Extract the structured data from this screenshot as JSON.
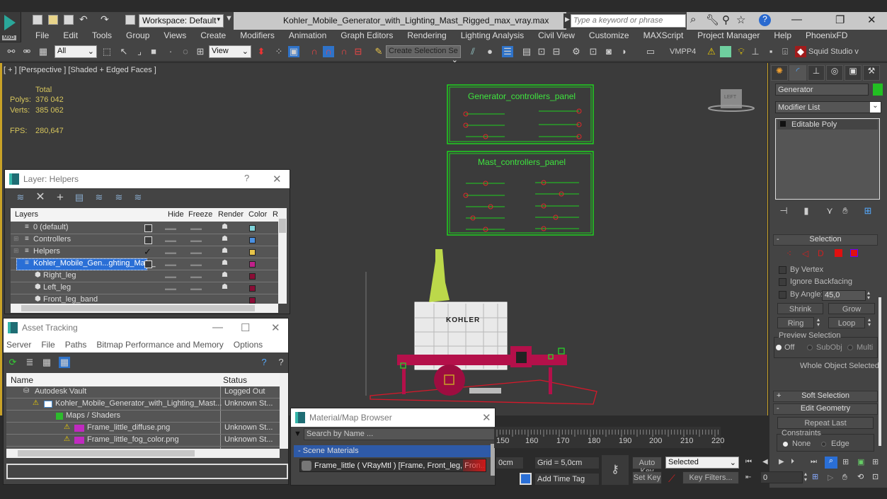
{
  "app": {
    "logo_label": "MXD",
    "workspace": "Workspace: Default",
    "title": "Kohler_Mobile_Generator_with_Lighting_Mast_Rigged_max_vray.max",
    "search_placeholder": "Type a keyword or phrase"
  },
  "menu": [
    "File",
    "Edit",
    "Tools",
    "Group",
    "Views",
    "Create",
    "Modifiers",
    "Animation",
    "Graph Editors",
    "Rendering",
    "Lighting Analysis",
    "Civil View",
    "Customize",
    "MAXScript",
    "Project Manager",
    "Help",
    "PhoenixFD"
  ],
  "toolbar": {
    "filter": "All",
    "ref_coord": "View",
    "named_selection": "Create Selection Se",
    "vmpp": "VMPP4",
    "squid": "Squid Studio v"
  },
  "viewport": {
    "label": "[ + ] [Perspective ] [Shaded + Edged Faces ]",
    "stats": {
      "total_label": "Total",
      "polys_label": "Polys:",
      "polys": "376 042",
      "verts_label": "Verts:",
      "verts": "385 062",
      "fps_label": "FPS:",
      "fps": "280,647"
    },
    "panels": [
      "Generator_controllers_panel",
      "Mast_controllers_panel"
    ],
    "brand_text": "KOHLER",
    "viewcube_label": "LEFT"
  },
  "layer_dialog": {
    "title": "Layer: Helpers",
    "columns": [
      "Layers",
      "",
      "Hide",
      "Freeze",
      "Render",
      "Color",
      "Ra"
    ],
    "rows": [
      {
        "name": "0 (default)",
        "active": false,
        "color": "#7fd3d9",
        "level": 0,
        "expand": false
      },
      {
        "name": "Controllers",
        "active": false,
        "color": "#4a90e2",
        "level": 0,
        "expand": true
      },
      {
        "name": "Helpers",
        "active": true,
        "color": "#e8c44a",
        "level": 0,
        "expand": true
      },
      {
        "name": "Kohler_Mobile_Gen...ghting_Mast_",
        "active": false,
        "color": "#c0208a",
        "level": 0,
        "expand": true,
        "selected": true
      },
      {
        "name": "Right_leg",
        "color": "#8a0d36",
        "level": 1
      },
      {
        "name": "Left_leg",
        "color": "#8a0d36",
        "level": 1
      },
      {
        "name": "Front_leg_band",
        "color": "#8a0d36",
        "level": 1
      }
    ]
  },
  "asset_dialog": {
    "title": "Asset Tracking",
    "menu": [
      "Server",
      "File",
      "Paths",
      "Bitmap Performance and Memory",
      "Options"
    ],
    "columns": [
      "Name",
      "Status"
    ],
    "rows": [
      {
        "name": "Autodesk Vault",
        "status": "Logged Out",
        "indent": 1
      },
      {
        "name": "Kohler_Mobile_Generator_with_Lighting_Mast...",
        "status": "Unknown St...",
        "indent": 2,
        "warn": true
      },
      {
        "name": "Maps / Shaders",
        "status": "",
        "indent": 3
      },
      {
        "name": "Frame_little_diffuse.png",
        "status": "Unknown St...",
        "indent": 4,
        "warn": true,
        "png": true
      },
      {
        "name": "Frame_little_fog_color.png",
        "status": "Unknown St...",
        "indent": 4,
        "warn": true,
        "png": true
      }
    ]
  },
  "material_browser": {
    "title": "Material/Map Browser",
    "search_placeholder": "Search by Name ...",
    "group": "- Scene Materials",
    "item": "Frame_little  ( VRayMtl )  [Frame, Front_leg, Fron..."
  },
  "command_panel": {
    "object_name": "Generator",
    "object_color": "#22c022",
    "modifier_list": "Modifier List",
    "stack": [
      "Editable Poly"
    ],
    "selection": {
      "title": "Selection",
      "by_vertex": "By Vertex",
      "ignore_backfacing": "Ignore Backfacing",
      "by_angle": "By Angle:",
      "angle_value": "45,0",
      "shrink": "Shrink",
      "grow": "Grow",
      "ring": "Ring",
      "loop": "Loop",
      "preview_title": "Preview Selection",
      "preview_options": [
        "Off",
        "SubObj",
        "Multi"
      ],
      "preview_selected": "Off",
      "status": "Whole Object Selected"
    },
    "soft_selection": "Soft Selection",
    "edit_geometry": "Edit Geometry",
    "repeat_last": "Repeat Last",
    "constraints_title": "Constraints",
    "constraints": [
      "None",
      "Edge"
    ]
  },
  "timeline": {
    "ticks": [
      "150",
      "160",
      "170",
      "180",
      "190",
      "200",
      "210",
      "220"
    ]
  },
  "bottom": {
    "coord_partial": "0cm",
    "grid": "Grid = 5,0cm",
    "add_time_tag": "Add Time Tag",
    "auto_key": "Auto Key",
    "set_key": "Set Key",
    "key_mode": "Selected",
    "key_filters": "Key Filters...",
    "frame": "0"
  }
}
